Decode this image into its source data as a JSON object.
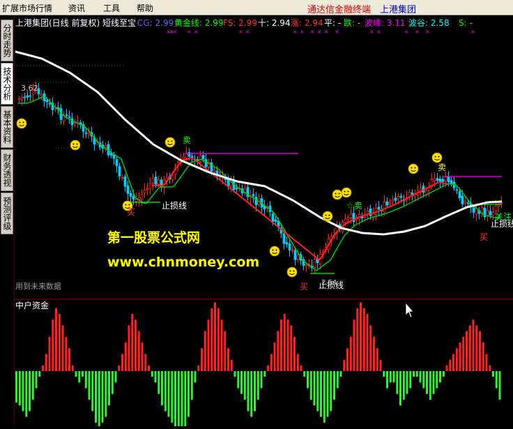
{
  "menu": {
    "items": [
      "扩展市场行情",
      "资讯",
      "工具",
      "帮助"
    ],
    "brand": "通达信金融终端",
    "stock": "上港集团"
  },
  "side_tabs": [
    "分时走势",
    "技术分析",
    "基本资料",
    "财务透视",
    "预测评级"
  ],
  "main_chart": {
    "header": {
      "title": "上港集团(日线 前复权) 短线至宝",
      "indicators": [
        {
          "label": "CG: 2.99",
          "color": "#6060ff"
        },
        {
          "label": "黄金线: 2.99",
          "color": "#00ff00"
        },
        {
          "label": "FS: 2.99",
          "color": "#ff3030"
        },
        {
          "label": "十: 2.94",
          "color": "#ffffff"
        },
        {
          "label": "涨: 2.94",
          "color": "#ff3030"
        },
        {
          "label": "平: -",
          "color": "#ffffff"
        },
        {
          "label": "跌: -",
          "color": "#00ff00"
        },
        {
          "label": "波峰: 3.11",
          "color": "#ff00ff"
        },
        {
          "label": "波谷: 2.58",
          "color": "#00ffff"
        },
        {
          "label": "S: -",
          "color": "#00ff00"
        }
      ]
    },
    "price_label": "3.62",
    "low_price_label": "2.54",
    "annotations": {
      "sell": "卖",
      "star_sell": "☆卖",
      "buy": "买",
      "stop_loss": "止损线",
      "attention": "关注"
    },
    "watermark_cn": "第一股票公式网",
    "watermark_url": "www.chnmoney.com",
    "future_data_note": "用到未来数据",
    "colors": {
      "up": "#ff2020",
      "down": "#00ccff",
      "ma_white": "#ffffff",
      "ma_green": "#00cc00",
      "magenta": "#ff00ff"
    }
  },
  "sub_chart": {
    "title": "中户资金",
    "colors": {
      "positive": "#ff2020",
      "negative": "#33ee33"
    }
  },
  "chart_data": {
    "type": "bar",
    "title": "中户资金",
    "series": [
      {
        "values": [
          -5.5,
          -6,
          -7,
          -8,
          -7,
          -5,
          -3,
          -1,
          1,
          3,
          6,
          9,
          11,
          10,
          8,
          6,
          4,
          1,
          -1,
          -2,
          -1,
          -3,
          -5,
          -7,
          -9,
          -10,
          -9,
          -8,
          -6,
          -4,
          -2,
          1,
          3,
          5,
          8,
          10,
          9,
          7,
          5,
          3,
          1,
          -1,
          -2,
          -4,
          -6,
          -7,
          -8,
          -9,
          -10,
          -11,
          -12,
          -10,
          -8,
          -5,
          -2,
          1,
          4,
          7,
          9,
          11,
          12,
          11,
          9,
          7,
          4,
          2,
          -1,
          -3,
          -4,
          -5,
          -7,
          -8,
          -7,
          -5,
          -3,
          -1,
          1,
          3,
          5,
          7,
          9,
          10,
          9,
          8,
          6,
          3,
          1,
          -1,
          -3,
          -5,
          -6,
          -7,
          -8,
          -9,
          -8,
          -7,
          -5,
          -3,
          -1,
          2,
          4,
          6,
          9,
          11,
          12,
          11,
          10,
          8,
          6,
          4,
          2,
          -1,
          -3,
          -2,
          -2,
          -4,
          -6,
          -5,
          -4,
          -3,
          -1,
          -1,
          -2,
          -3,
          -4,
          -5,
          -4,
          -3,
          -2,
          -1,
          1,
          2,
          3,
          4,
          5,
          6,
          7,
          8,
          9,
          8,
          7,
          5,
          3,
          1,
          -1,
          -3,
          -5
        ]
      }
    ]
  }
}
